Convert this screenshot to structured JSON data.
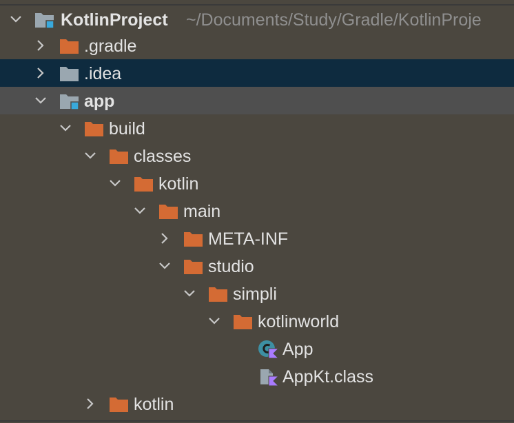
{
  "project": {
    "name": "KotlinProject",
    "path": "~/Documents/Study/Gradle/KotlinProje"
  },
  "nodes": [
    {
      "label": ".gradle"
    },
    {
      "label": ".idea"
    },
    {
      "label": "app"
    },
    {
      "label": "build"
    },
    {
      "label": "classes"
    },
    {
      "label": "kotlin"
    },
    {
      "label": "main"
    },
    {
      "label": "META-INF"
    },
    {
      "label": "studio"
    },
    {
      "label": "simpli"
    },
    {
      "label": "kotlinworld"
    },
    {
      "label": "App"
    },
    {
      "label": "AppKt.class"
    },
    {
      "label": "kotlin"
    }
  ],
  "colors": {
    "background": "#4b473f",
    "selection": "#0e2b3f",
    "hover": "#4f4f4f",
    "folder": "#d46b34",
    "module_folder": "#9aa7b0",
    "module_badge": "#39a9dc",
    "text": "#e3e3e3",
    "path_text": "#8f8f8f",
    "kotlin_badge": "#a97bff"
  }
}
